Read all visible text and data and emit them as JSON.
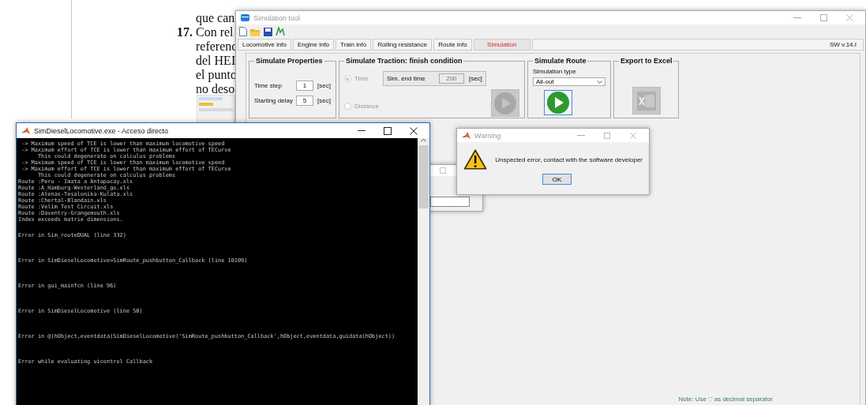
{
  "document": {
    "lines": [
      {
        "text": "que can"
      },
      {
        "number": "17.",
        "text": "Con rel"
      },
      {
        "text": "referenc"
      },
      {
        "text": "del HEI"
      },
      {
        "text": "el punto"
      },
      {
        "text": "no deso"
      }
    ]
  },
  "simulation_tool": {
    "title": "Simulation tool",
    "tabs": [
      {
        "label": "Locomotive info",
        "selected": false
      },
      {
        "label": "Engine info",
        "selected": false
      },
      {
        "label": "Train info",
        "selected": false
      },
      {
        "label": "Rolling resistance",
        "selected": false
      },
      {
        "label": "Route info",
        "selected": false
      },
      {
        "label": "Simulation",
        "selected": true
      }
    ],
    "version": "SW v.14.I",
    "properties": {
      "title": "Simulate Properties",
      "fields": [
        {
          "label": "Time step",
          "value": "1",
          "unit": "[sec]"
        },
        {
          "label": "Starting delay",
          "value": "5",
          "unit": "[sec]"
        }
      ]
    },
    "traction": {
      "title": "Simulate Traction: finish condition",
      "options": [
        {
          "label": "Time",
          "selected": true,
          "disabled": true
        },
        {
          "label": "Distance",
          "selected": false,
          "disabled": true
        }
      ],
      "end_time": {
        "label": "Sim. end time",
        "value": "200",
        "unit": "[sec]",
        "disabled": true
      },
      "run_disabled": true
    },
    "route": {
      "title": "Simulate Route",
      "type_label": "Simulation type",
      "type_value": "All-out",
      "run_disabled": false
    },
    "export": {
      "title": "Export to Excel",
      "disabled": true
    },
    "note": "Note: Use '.' as decimal separator"
  },
  "console": {
    "title": "SimDieselLocomotive.exe - Acceso directo",
    "output": [
      " -> Maximum speed of TCE is lower than maximum locomotive speed",
      " -> Maximum effort of TCE is lower than maximum effort of TECurve",
      "      This could degenerate on calculus problems",
      " -> Maximum speed of TCE is lower than maximum locomotive speed",
      " -> Maximum effort of TCE is lower than maximum effort of TECurve",
      "      This could degenerate on calculus problems",
      "Route :Peru - Imata a Antapacay.xls",
      "Route :A_Hamburg-Westerland_go.xls",
      "Route :Atenas-Tesalonika-Kulata.xls",
      "Route :Chertal-Blandain.xls",
      "Route :Velim Test Circuit.xls",
      "Route :Daventry-Grangemouth.xls",
      "Index exceeds matrix dimensions."
    ],
    "errors": [
      "Error in Sim_routeDUAL (line 332)",
      "Error in SimDieselLocomotive>SimRoute_pushbutton_Callback (line 10109)",
      "Error in gui_mainfcn (line 96)",
      "Error in SimDieselLocomotive (line 58)",
      "Error in @(hObject,eventdata)SimDieselLocomotive('SimRoute_pushbutton_Callback',hObject,eventdata,guidata(hObject))",
      "Error while evaluating uicontrol Callback"
    ]
  },
  "warning": {
    "title": "Warning",
    "message": "Unspected error, contact with the software developer",
    "button": "OK"
  }
}
